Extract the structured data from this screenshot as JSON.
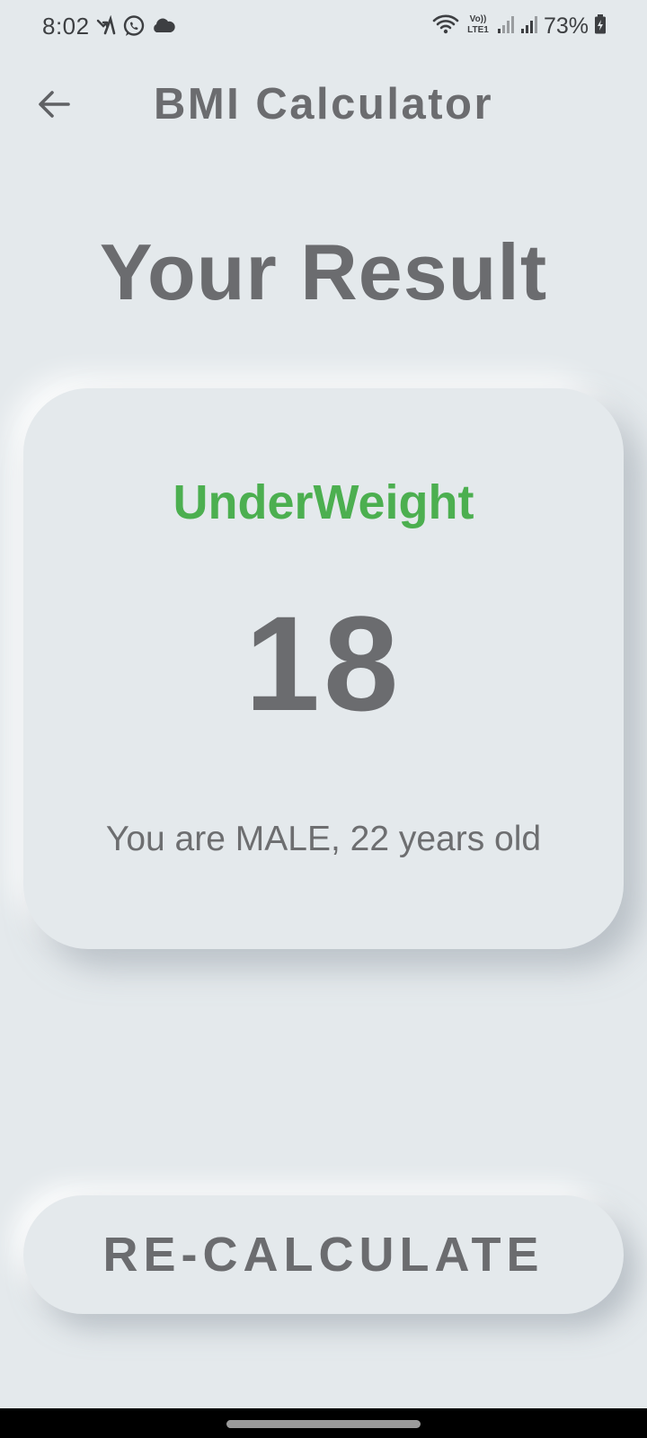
{
  "status_bar": {
    "time": "8:02",
    "battery_percent": "73%",
    "network_label": "VoLTE1",
    "left_icons": [
      "missed-call-icon",
      "whatsapp-icon",
      "cloud-icon"
    ],
    "right_icons": [
      "wifi-icon",
      "volte-icon",
      "signal-1-icon",
      "signal-2-icon",
      "battery-charging-icon"
    ]
  },
  "app_bar": {
    "title": "BMI Calculator",
    "back_icon": "arrow-back-icon"
  },
  "page": {
    "title": "Your Result"
  },
  "result": {
    "category": "UnderWeight",
    "category_color": "#4caf50",
    "bmi_value": "18",
    "description": "You are MALE, 22 years old"
  },
  "actions": {
    "recalculate_label": "RE-CALCULATE"
  },
  "theme": {
    "background": "#e4e9ec",
    "text_primary": "#6b6c6f",
    "accent_green": "#4caf50"
  }
}
